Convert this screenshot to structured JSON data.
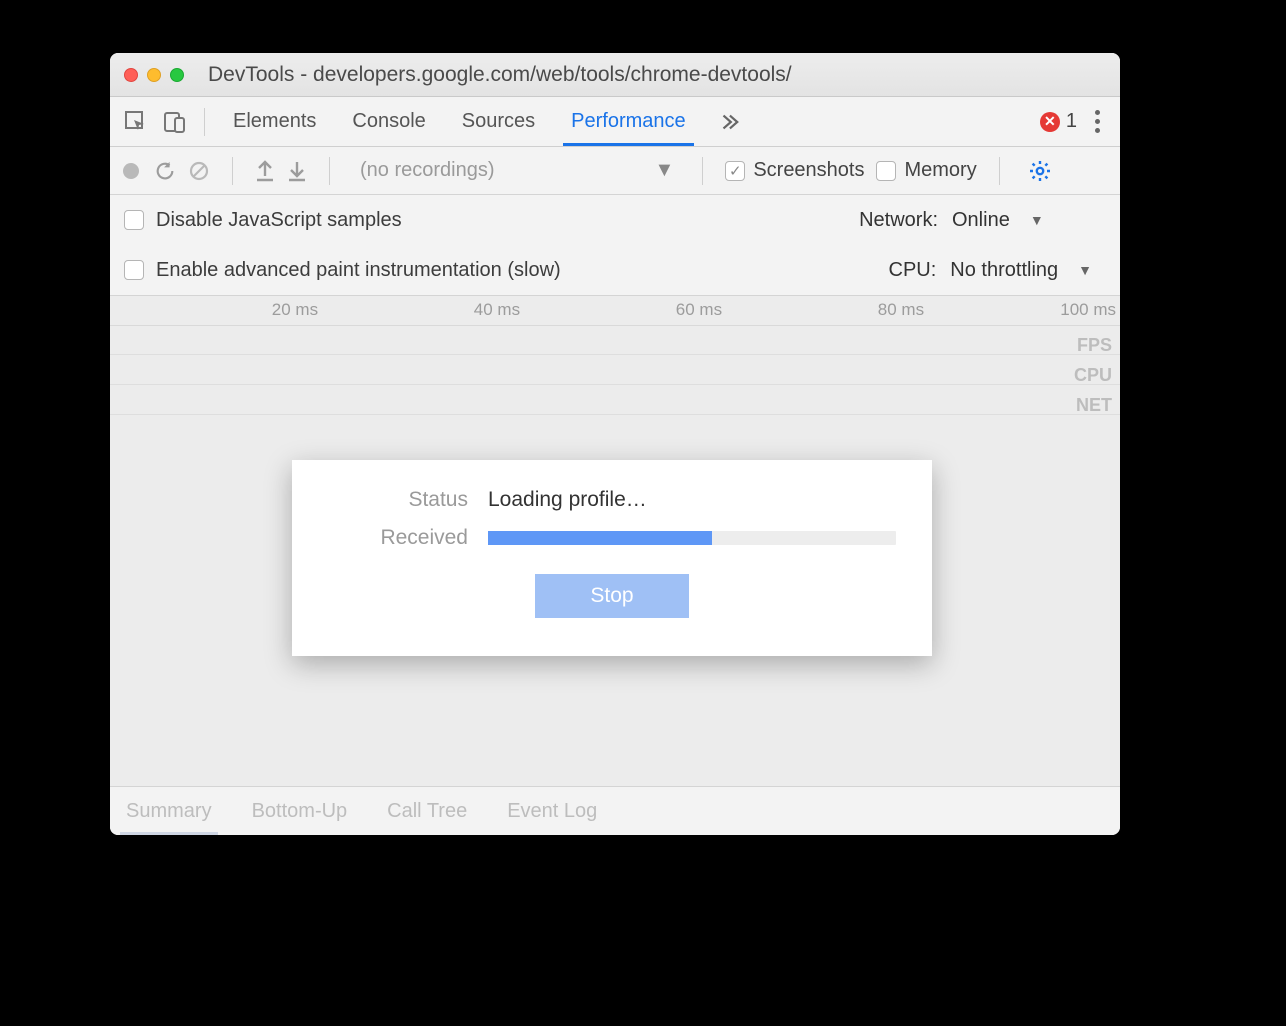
{
  "window": {
    "title": "DevTools - developers.google.com/web/tools/chrome-devtools/"
  },
  "tabs": {
    "items": [
      "Elements",
      "Console",
      "Sources",
      "Performance"
    ],
    "active_index": 3,
    "error_count": "1"
  },
  "toolbar": {
    "recordings_label": "(no recordings)",
    "screenshots_label": "Screenshots",
    "memory_label": "Memory"
  },
  "settings": {
    "disable_js_label": "Disable JavaScript samples",
    "enable_paint_label": "Enable advanced paint instrumentation (slow)",
    "network_label": "Network:",
    "network_value": "Online",
    "cpu_label": "CPU:",
    "cpu_value": "No throttling"
  },
  "ruler": {
    "ticks": [
      "20 ms",
      "40 ms",
      "60 ms",
      "80 ms",
      "100 ms"
    ],
    "lanes": [
      "FPS",
      "CPU",
      "NET"
    ]
  },
  "modal": {
    "status_label": "Status",
    "status_value": "Loading profile…",
    "received_label": "Received",
    "progress_pct": 55,
    "stop_label": "Stop"
  },
  "bottom_tabs": {
    "items": [
      "Summary",
      "Bottom-Up",
      "Call Tree",
      "Event Log"
    ],
    "active_index": 0
  }
}
